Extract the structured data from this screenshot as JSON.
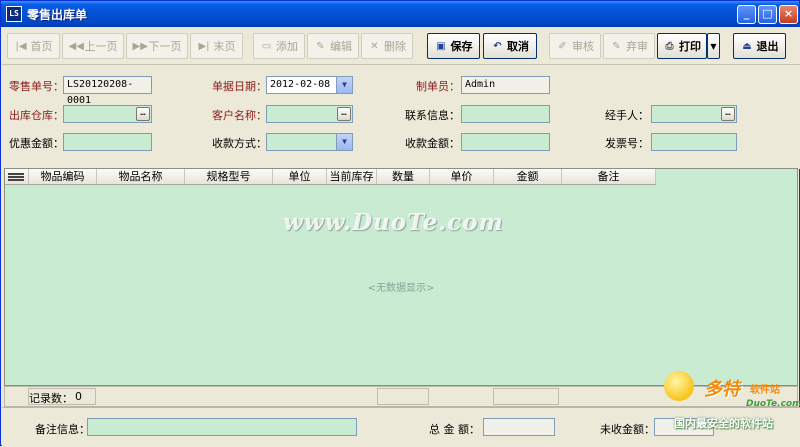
{
  "window": {
    "title": "零售出库单",
    "icon_text": "LS"
  },
  "toolbar": {
    "first": "首页",
    "prev": "上一页",
    "next": "下一页",
    "last": "末页",
    "add": "添加",
    "edit": "编辑",
    "delete": "删除",
    "save": "保存",
    "cancel": "取消",
    "audit": "审核",
    "abandon": "弃审",
    "print": "打印",
    "exit": "退出"
  },
  "form": {
    "order_no_label": "零售单号：",
    "order_no": "LS20120208-0001",
    "date_label": "单据日期：",
    "date": "2012-02-08",
    "maker_label": "制单员：",
    "maker": "Admin",
    "warehouse_label": "出库仓库：",
    "warehouse": "",
    "customer_label": "客户名称：",
    "customer": "",
    "contact_label": "联系信息：",
    "contact": "",
    "handler_label": "经手人：",
    "handler": "",
    "discount_label": "优惠金额：",
    "discount": "",
    "pay_method_label": "收款方式：",
    "pay_method": "",
    "received_label": "收款金额：",
    "received": "",
    "invoice_label": "发票号：",
    "invoice": ""
  },
  "grid": {
    "columns": [
      "物品编码",
      "物品名称",
      "规格型号",
      "单位",
      "当前库存",
      "数量",
      "单价",
      "金额",
      "备注"
    ],
    "empty_text": "<无数据显示>",
    "watermark": "www.DuoTe.com"
  },
  "summary": {
    "record_count_label": "记录数：",
    "record_count": "0"
  },
  "bottom": {
    "remark_label": "备注信息：",
    "remark": "",
    "total_label": "总 金 额：",
    "total": "",
    "unpaid_label": "未收金额：",
    "unpaid": ""
  },
  "logo": {
    "brand": "多特",
    "brand_small": "软件站",
    "url": "DuoTe.com",
    "tagline": "国内最安全的软件站"
  }
}
